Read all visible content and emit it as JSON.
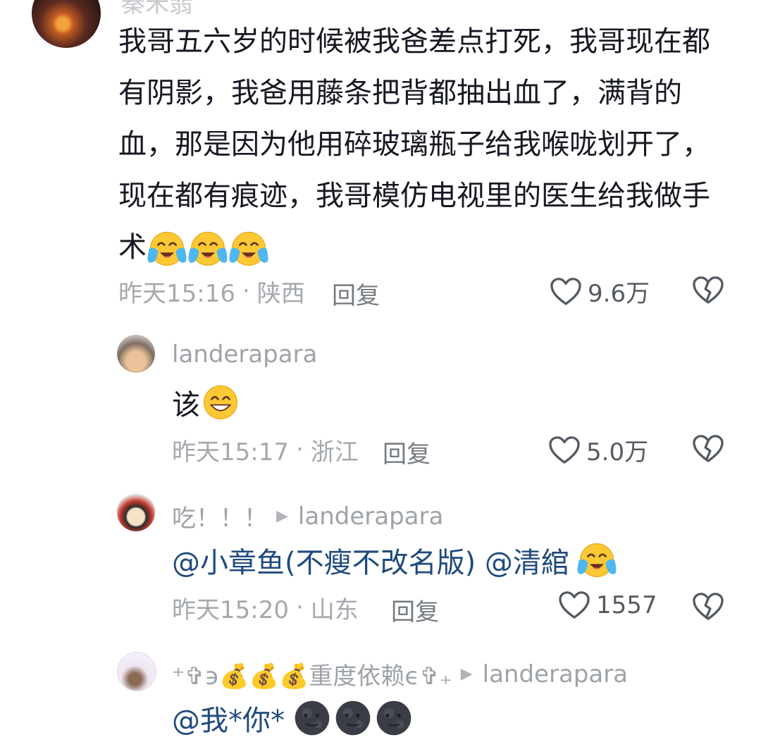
{
  "main_comment": {
    "username": "秦禾翡",
    "text_lines": [
      "我哥五六岁的时候被我爸差点打死，我哥现在都",
      "有阴影，我爸用藤条把背都抽出血了，满背的",
      "血，那是因为他用碎玻璃瓶子给我喉咙划开了，",
      "现在都有痕迹，我哥模仿电视里的医生给我做手",
      "术"
    ],
    "time": "昨天15:16",
    "location": "陕西",
    "reply_label": "回复",
    "likes": "9.6万"
  },
  "replies": [
    {
      "username": "landerapara",
      "text": "该",
      "time": "昨天15:17",
      "location": "浙江",
      "reply_label": "回复",
      "likes": "5.0万"
    },
    {
      "username": "吃！！！",
      "reply_to": "landerapara",
      "text": "@小章鱼(不瘦不改名版) @清綰",
      "time": "昨天15:20",
      "location": "山东",
      "reply_label": "回复",
      "likes": "1557"
    },
    {
      "username": "⁺✞϶💰💰💰重度依赖ϵ✞₊",
      "reply_to": "landerapara",
      "text": "@我*你*"
    }
  ],
  "icons": [
    "heart-icon",
    "broken-heart-icon",
    "play-triangle-icon",
    "crying-emoji",
    "grinning-emoji",
    "moon-face-emoji"
  ],
  "colors": {
    "mention": "#1f4a7e",
    "meta": "#a4a9ae",
    "text": "#161823"
  }
}
